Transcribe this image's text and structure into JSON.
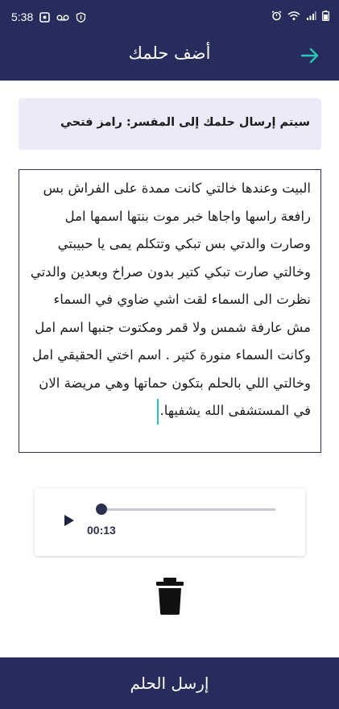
{
  "status_bar": {
    "time": "5:38"
  },
  "app_bar": {
    "title": "أضف حلمك",
    "back_icon": "arrow-right-icon",
    "accent_color": "#2bc4b4",
    "background_color": "#262c5c"
  },
  "notice": {
    "text": "سيتم إرسال حلمك إلى المفسر: رامز فتحي"
  },
  "dream_input": {
    "value": "البيت وعندها خالتي كانت ممدة على الفراش بس رافعة راسها واجاها خبر موت بنتها اسمها امل وصارت والدتي بس تبكي وتتكلم يمى يا حبيبتي وخالتي صارت تبكي كتير بدون صراخ وبعدين والدتي نظرت الى السماء لقت اشي ضاوي في السماء مش عارفة شمس ولا قمر ومكتوت جنبها اسم امل وكانت السماء منورة كتير . اسم اختي الحقيقي امل وخالتي اللي بالحلم بتكون حماتها وهي مريضة الان في المستشفى الله يشفيها."
  },
  "audio_player": {
    "play_icon": "play-icon",
    "time": "00:13",
    "progress": 0.0
  },
  "delete_icon": "trash-icon",
  "send_button": {
    "label": "إرسل الحلم"
  }
}
